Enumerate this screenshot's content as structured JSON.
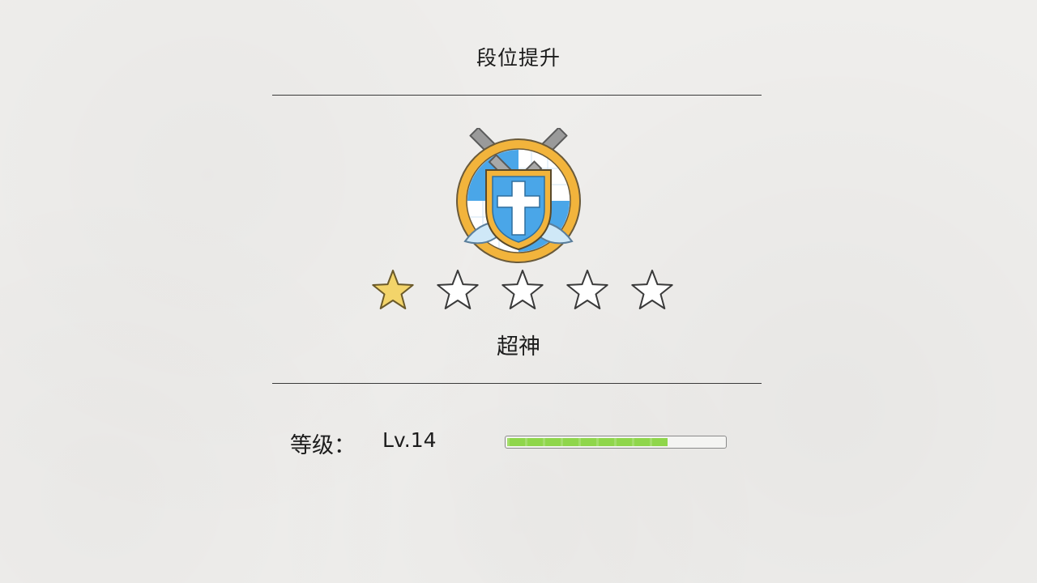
{
  "header": {
    "title": "段位提升"
  },
  "rank": {
    "emblem": "shield-crossed-swords-icon",
    "name": "超神",
    "stars_total": 5,
    "stars_filled": 1
  },
  "level": {
    "label": "等级：",
    "value": "Lv.14",
    "progress": 0.74
  },
  "colors": {
    "star_filled": "#f3d46a",
    "progress_fill": "#8fd64b",
    "shield_blue": "#4aa6e8",
    "shield_gold": "#f2b43c"
  }
}
